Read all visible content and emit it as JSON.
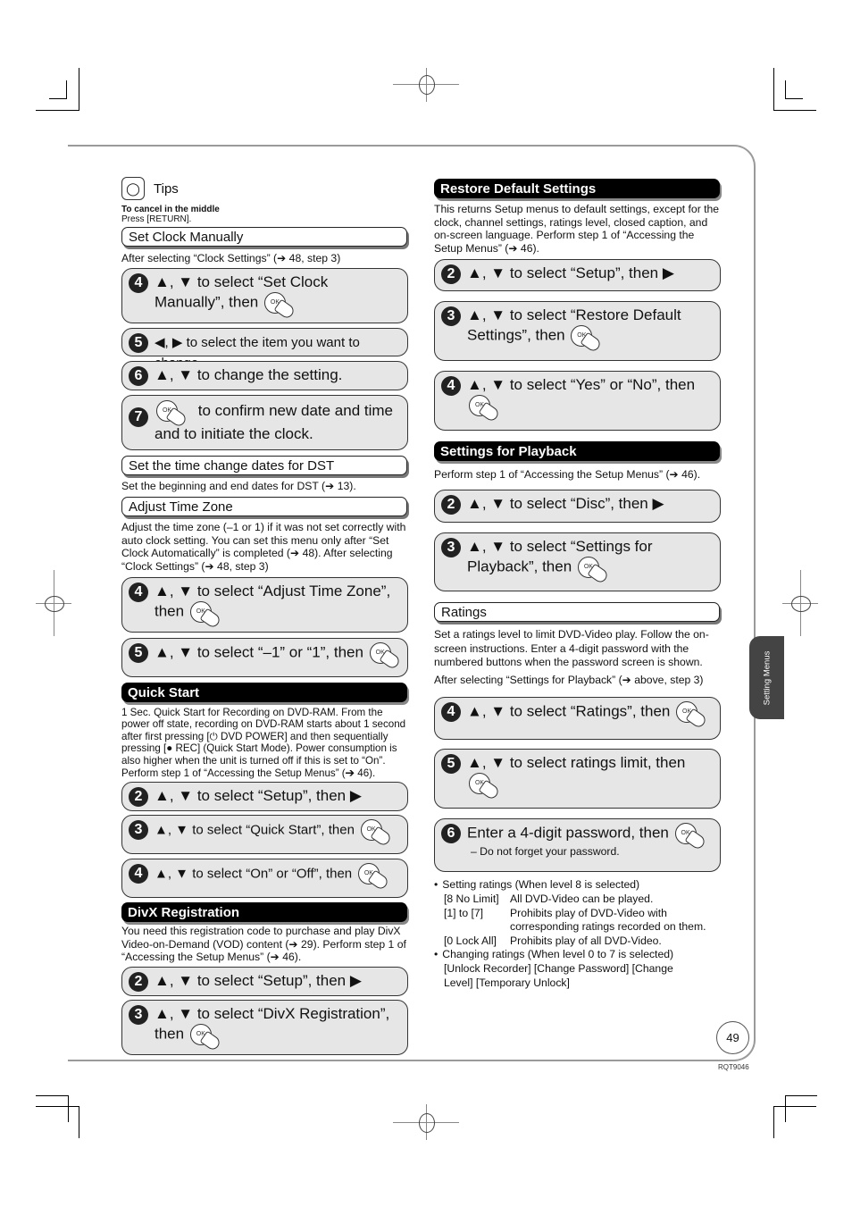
{
  "tips": {
    "icon": "lightbulb-icon",
    "label": "Tips",
    "title": "To cancel in the middle",
    "text": "Press [RETURN]."
  },
  "left": {
    "set_clock": {
      "heading": "Set Clock Manually",
      "intro": "After selecting “Clock Settings” (➔ 48, step 3)",
      "steps": [
        {
          "num": "4",
          "text": "▲, ▼ to select “Set Clock Manually”, then"
        },
        {
          "num": "5",
          "text": "◀, ▶ to select the item you want to change."
        },
        {
          "num": "6",
          "text": "▲, ▼ to change the setting."
        },
        {
          "num": "7",
          "text": "to confirm new date and time and to initiate the clock."
        }
      ]
    },
    "dst": {
      "heading": "Set the time change dates for DST",
      "text": "Set the beginning and end dates for DST (➔ 13)."
    },
    "time_zone": {
      "heading": "Adjust Time Zone",
      "intro": "Adjust the time zone (–1 or 1) if it was not set correctly with auto clock setting. You can set this menu only after “Set Clock Automatically” is completed (➔ 48). After selecting “Clock Settings” (➔ 48, step 3)",
      "steps": [
        {
          "num": "4",
          "text": "▲, ▼ to select “Adjust Time Zone”, then"
        },
        {
          "num": "5",
          "text": "▲, ▼ to select “–1” or “1”, then"
        }
      ]
    },
    "quick_start": {
      "heading": "Quick Start",
      "intro": "1 Sec. Quick Start for Recording on DVD-RAM. From the power off state, recording on DVD-RAM starts about 1 second after first pressing [⏻ DVD POWER] and then sequentially pressing [● REC] (Quick Start Mode). Power consumption is also higher when the unit is turned off if this is set to “On”. Perform step 1 of “Accessing the Setup Menus” (➔ 46).",
      "steps": [
        {
          "num": "2",
          "text": "▲, ▼ to select  “Setup”, then ▶"
        },
        {
          "num": "3",
          "text": "▲, ▼ to select “Quick Start”, then"
        },
        {
          "num": "4",
          "text": "▲, ▼ to select “On” or “Off”, then"
        }
      ]
    },
    "divx": {
      "heading": "DivX Registration",
      "intro": "You need this registration code to purchase and play DivX Video-on-Demand (VOD) content (➔ 29). Perform step 1 of “Accessing the Setup Menus” (➔ 46).",
      "steps": [
        {
          "num": "2",
          "text": "▲, ▼ to select  “Setup”, then ▶"
        },
        {
          "num": "3",
          "text": "▲, ▼ to select “DivX Registration”, then"
        }
      ]
    }
  },
  "right": {
    "restore": {
      "heading": "Restore Default Settings",
      "intro": "This returns Setup menus to default settings, except for the clock, channel settings, ratings level, closed caption, and on-screen language. Perform step 1 of “Accessing the Setup Menus” (➔ 46).",
      "steps": [
        {
          "num": "2",
          "text": "▲, ▼ to select “Setup”, then ▶"
        },
        {
          "num": "3",
          "text": "▲, ▼ to select “Restore Default Settings”, then"
        },
        {
          "num": "4",
          "text": "▲, ▼ to select “Yes” or “No”, then"
        }
      ]
    },
    "playback": {
      "heading": "Settings for Playback",
      "intro": "Perform step 1 of “Accessing the Setup Menus” (➔ 46).",
      "steps": [
        {
          "num": "2",
          "text": "▲, ▼ to select “Disc”, then ▶"
        },
        {
          "num": "3",
          "text": "▲, ▼ to select “Settings for Playback”, then"
        }
      ]
    },
    "ratings": {
      "heading": "Ratings",
      "intro": "Set a ratings level to limit DVD-Video play. Follow the on-screen instructions. Enter a 4-digit password with the numbered buttons when the password screen is shown.",
      "intro2": "After selecting “Settings for Playback” (➔ above, step 3)",
      "steps": [
        {
          "num": "4",
          "text": "▲, ▼ to select “Ratings”, then"
        },
        {
          "num": "5",
          "text": "▲, ▼ to select ratings limit, then"
        },
        {
          "num": "6",
          "text": "Enter a 4-digit password, then",
          "note": "–   Do not forget your password."
        }
      ],
      "bullet1": "Setting ratings (When level 8 is selected)",
      "levels": [
        {
          "key": "[8 No Limit]",
          "desc": "All DVD-Video can be played."
        },
        {
          "key": "[1] to [7]",
          "desc": "Prohibits play of DVD-Video with corresponding ratings recorded on them."
        },
        {
          "key": "[0 Lock All]",
          "desc": "Prohibits play of all DVD-Video."
        }
      ],
      "bullet2": "Changing ratings (When level 0 to 7 is selected)",
      "bullet2_text": "[Unlock Recorder] [Change Password] [Change Level] [Temporary Unlock]"
    }
  },
  "side_tab": "Setting Menus",
  "page_number": "49",
  "doc_code": "RQT9046",
  "ok_label": "OK"
}
